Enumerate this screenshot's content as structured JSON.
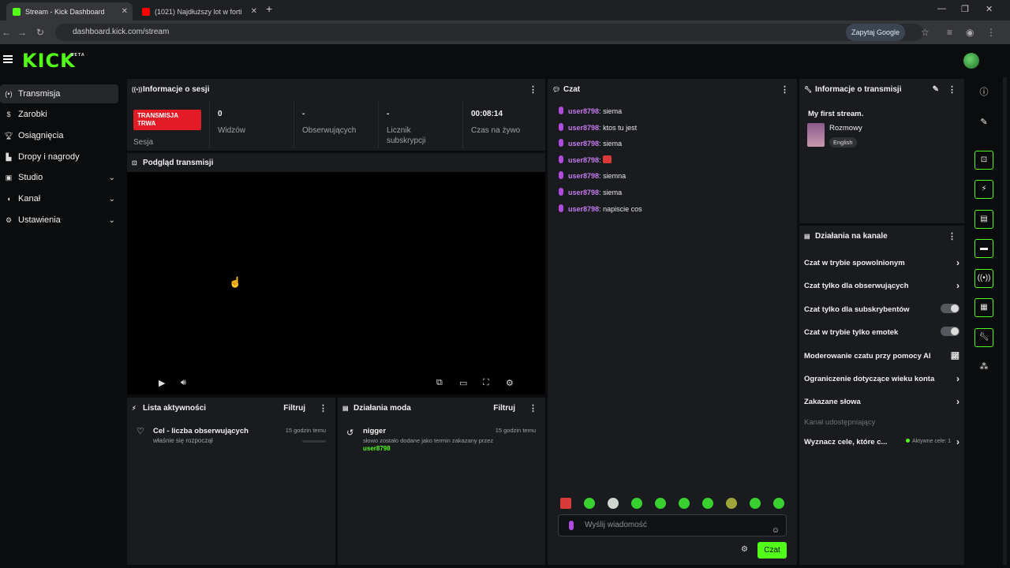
{
  "browser": {
    "tabs": [
      {
        "title": "Stream - Kick Dashboard",
        "active": true
      },
      {
        "title": "(1021) Najdłuższy lot w forti",
        "active": false
      }
    ],
    "url": "dashboard.kick.com/stream",
    "ask_google": "Zapytaj Google"
  },
  "brand": {
    "logo": "KICK",
    "logo_sup": "BETA",
    "accent": "#53fc18"
  },
  "sidebar": {
    "items": [
      {
        "label": "Transmisja",
        "icon": "broadcast-icon",
        "active": true
      },
      {
        "label": "Zarobki",
        "icon": "money-icon"
      },
      {
        "label": "Osiągnięcia",
        "icon": "trophy-icon"
      },
      {
        "label": "Dropy i nagrody",
        "icon": "gift-icon"
      },
      {
        "label": "Studio",
        "icon": "studio-icon",
        "expandable": true
      },
      {
        "label": "Kanał",
        "icon": "channel-icon",
        "expandable": true
      },
      {
        "label": "Ustawienia",
        "icon": "gear-icon",
        "expandable": true
      }
    ]
  },
  "session": {
    "title": "Informacje o sesji",
    "badge": "TRANSMISJA TRWA",
    "badge_label": "Sesja",
    "stats": [
      {
        "value": "0",
        "label": "Widzów"
      },
      {
        "value": "-",
        "label": "Obserwujących"
      },
      {
        "value": "-",
        "label": "Licznik subskrypcji"
      },
      {
        "value": "00:08:14",
        "label": "Czas na żywo"
      }
    ]
  },
  "preview": {
    "title": "Podgląd transmisji"
  },
  "activity": {
    "title": "Lista aktywności",
    "filter": "Filtruj",
    "items": [
      {
        "title": "Cel - liczba obserwujących",
        "subtitle": "właśnie się rozpoczął",
        "time": "15 godzin temu"
      }
    ]
  },
  "modactions": {
    "title": "Działania moda",
    "filter": "Filtruj",
    "items": [
      {
        "title": "nigger",
        "subtitle": "słowo zostało dodane jako termin zakazany przez",
        "user": "user8798",
        "time": "15 godzin temu"
      }
    ]
  },
  "chat": {
    "title": "Czat",
    "messages": [
      {
        "user": "user8798",
        "text": "siema"
      },
      {
        "user": "user8798",
        "text": "ktos tu jest"
      },
      {
        "user": "user8798",
        "text": "siema"
      },
      {
        "user": "user8798",
        "text": ""
      },
      {
        "user": "user8798",
        "text": "siemna"
      },
      {
        "user": "user8798",
        "text": "siema"
      },
      {
        "user": "user8798",
        "text": "napiscie cos"
      }
    ],
    "input_placeholder": "Wyślij wiadomość",
    "send_label": "Czat"
  },
  "stream_info": {
    "title": "Informacje o transmisji",
    "stream_title": "My first stream.",
    "category": "Rozmowy",
    "language": "English"
  },
  "channel_actions": {
    "title": "Działania na kanale",
    "items": [
      {
        "label": "Czat w trybie spowolnionym",
        "control": "arrow"
      },
      {
        "label": "Czat tylko dla obserwujących",
        "control": "arrow"
      },
      {
        "label": "Czat tylko dla subskrybentów",
        "control": "toggle",
        "on": false
      },
      {
        "label": "Czat w trybie tylko emotek",
        "control": "toggle",
        "on": false
      },
      {
        "label": "Moderowanie czatu przy pomocy AI",
        "control": "external"
      },
      {
        "label": "Ograniczenie dotyczące wieku konta",
        "control": "arrow"
      },
      {
        "label": "Zakazane słowa",
        "control": "arrow"
      },
      {
        "label": "Kanał udostępniający",
        "control": "none",
        "disabled": true
      },
      {
        "label": "Wyznacz cele, które c...",
        "control": "arrow",
        "extra": "Aktywne cele: 1"
      }
    ]
  }
}
